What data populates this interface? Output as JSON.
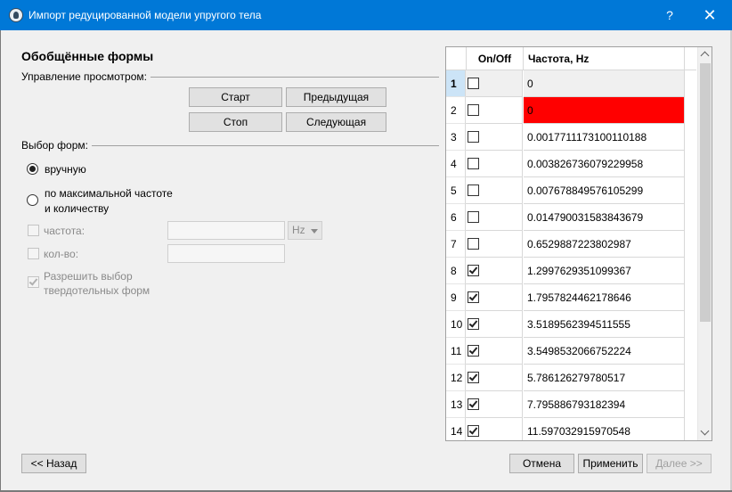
{
  "window": {
    "title": "Импорт редуцированной модели упругого тела",
    "help": "?",
    "close": "✕"
  },
  "heading": "Обобщённые формы",
  "view_control": {
    "label": "Управление просмотром:",
    "start": "Старт",
    "previous": "Предыдущая",
    "stop": "Стоп",
    "next": "Следующая"
  },
  "selection": {
    "label": "Выбор форм:",
    "manual": "вручную",
    "by_max_line1": "по максимальной частоте",
    "by_max_line2": "и количеству",
    "frequency_label": "частота:",
    "frequency_value": "",
    "unit": "Hz",
    "count_label": "кол-во:",
    "count_value": "",
    "allow_line1": "Разрешить выбор",
    "allow_line2": "твердотельных форм",
    "manual_checked": true,
    "allow_checked": true
  },
  "table": {
    "col_onoff": "On/Off",
    "col_freq": "Частота, Hz",
    "rows": [
      {
        "num": "1",
        "checked": false,
        "freq": "0"
      },
      {
        "num": "2",
        "checked": false,
        "freq": "0"
      },
      {
        "num": "3",
        "checked": false,
        "freq": "0.0017711173100110188"
      },
      {
        "num": "4",
        "checked": false,
        "freq": "0.003826736079229958"
      },
      {
        "num": "5",
        "checked": false,
        "freq": "0.007678849576105299"
      },
      {
        "num": "6",
        "checked": false,
        "freq": "0.014790031583843679"
      },
      {
        "num": "7",
        "checked": false,
        "freq": "0.6529887223802987"
      },
      {
        "num": "8",
        "checked": true,
        "freq": "1.2997629351099367"
      },
      {
        "num": "9",
        "checked": true,
        "freq": "1.7957824462178646"
      },
      {
        "num": "10",
        "checked": true,
        "freq": "3.5189562394511555"
      },
      {
        "num": "11",
        "checked": true,
        "freq": "3.5498532066752224"
      },
      {
        "num": "12",
        "checked": true,
        "freq": "5.786126279780517"
      },
      {
        "num": "13",
        "checked": true,
        "freq": "7.795886793182394"
      },
      {
        "num": "14",
        "checked": true,
        "freq": "11.597032915970548"
      }
    ],
    "highlight_color": "#ff0000"
  },
  "footer": {
    "back": "<< Назад",
    "cancel": "Отмена",
    "apply": "Применить",
    "next": "Далее >>"
  }
}
